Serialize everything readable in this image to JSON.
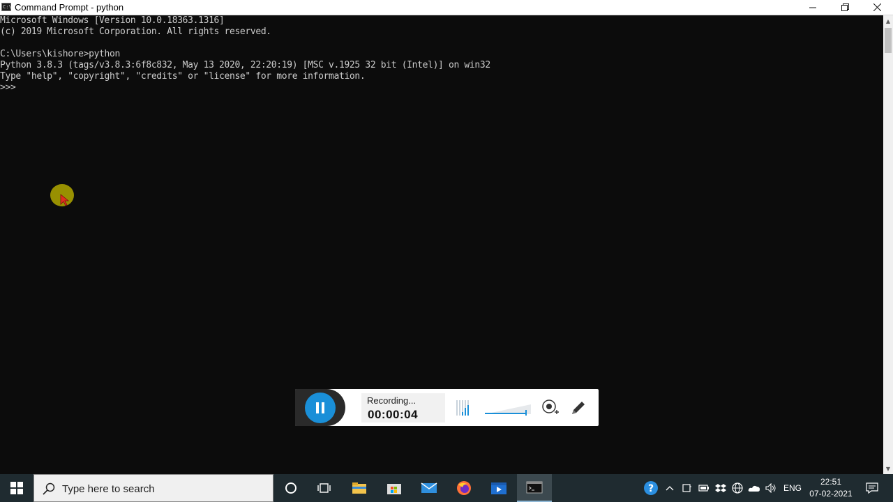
{
  "window": {
    "title": "Command Prompt - python",
    "icon": "console-icon",
    "controls": [
      "minimize-icon",
      "restore-icon",
      "close-icon"
    ]
  },
  "console": {
    "lines": [
      "Microsoft Windows [Version 10.0.18363.1316]",
      "(c) 2019 Microsoft Corporation. All rights reserved.",
      "",
      "C:\\Users\\kishore>python",
      "Python 3.8.3 (tags/v3.8.3:6f8c832, May 13 2020, 22:20:19) [MSC v.1925 32 bit (Intel)] on win32",
      "Type \"help\", \"copyright\", \"credits\" or \"license\" for more information.",
      ">>>"
    ],
    "text_color": "#cccccc",
    "background": "#0c0c0c"
  },
  "recorder": {
    "status_label": "Recording...",
    "elapsed": "00:00:04",
    "accent": "#1a8fd8",
    "volume_level": 0.9,
    "tools": [
      "audio-level-icon",
      "volume-slider",
      "webcam-icon",
      "pen-icon"
    ]
  },
  "taskbar": {
    "search_placeholder": "Type here to search",
    "apps": [
      "cortana-icon",
      "task-view-icon",
      "file-explorer-icon",
      "store-icon",
      "mail-icon",
      "firefox-icon",
      "video-editor-icon",
      "command-prompt-icon"
    ],
    "tray": {
      "icons": [
        "help-icon",
        "chevron-up-icon",
        "meet-now-icon",
        "battery-icon",
        "dropbox-icon",
        "network-icon",
        "onedrive-icon",
        "speaker-icon"
      ],
      "language": "ENG",
      "time": "22:51",
      "date": "07-02-2021"
    },
    "background": "#1f2b30"
  }
}
